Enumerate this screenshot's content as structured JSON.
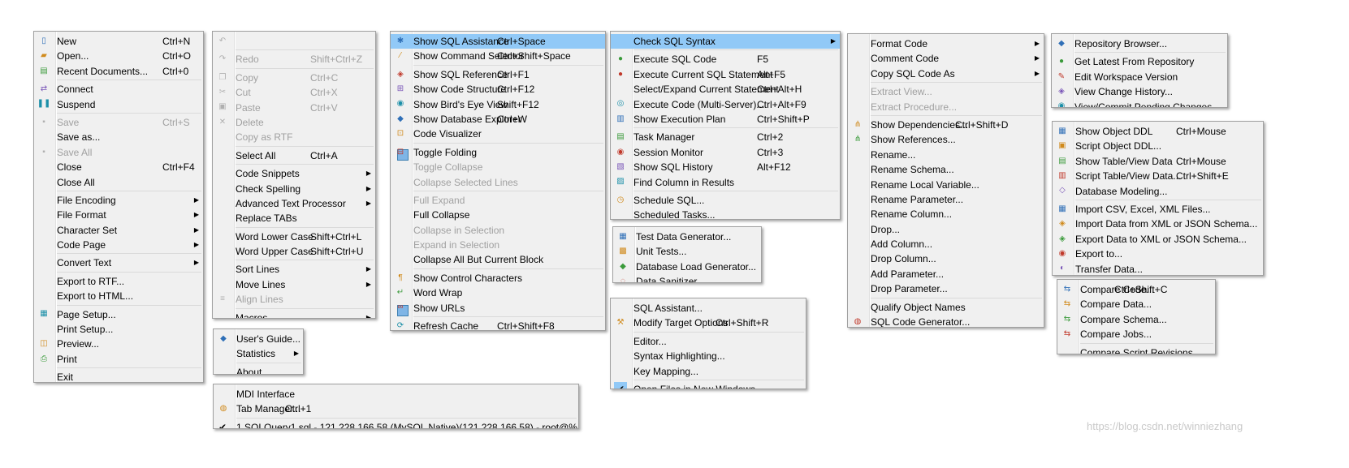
{
  "file_menu": [
    {
      "label": "New",
      "shortcut": "Ctrl+N",
      "icon": "new-file-icon"
    },
    {
      "label": "Open...",
      "shortcut": "Ctrl+O",
      "icon": "open-folder-icon"
    },
    {
      "label": "Recent Documents...",
      "shortcut": "Ctrl+0",
      "icon": "recent-docs-icon"
    },
    {
      "sep": true
    },
    {
      "label": "Connect",
      "icon": "connect-icon"
    },
    {
      "label": "Suspend",
      "icon": "pause-icon"
    },
    {
      "sep": true
    },
    {
      "label": "Save",
      "shortcut": "Ctrl+S",
      "icon": "save-icon",
      "disabled": true
    },
    {
      "label": "Save as..."
    },
    {
      "label": "Save All",
      "icon": "save-all-icon",
      "disabled": true
    },
    {
      "label": "Close",
      "shortcut": "Ctrl+F4"
    },
    {
      "label": "Close All"
    },
    {
      "sep": true
    },
    {
      "label": "File Encoding",
      "submenu": true
    },
    {
      "label": "File Format",
      "submenu": true
    },
    {
      "label": "Character Set",
      "submenu": true
    },
    {
      "label": "Code Page",
      "submenu": true
    },
    {
      "sep": true
    },
    {
      "label": "Convert Text",
      "submenu": true
    },
    {
      "sep": true
    },
    {
      "label": "Export to RTF..."
    },
    {
      "label": "Export to HTML..."
    },
    {
      "sep": true
    },
    {
      "label": "Page Setup...",
      "icon": "page-setup-icon"
    },
    {
      "label": "Print Setup..."
    },
    {
      "label": "Preview...",
      "icon": "preview-icon"
    },
    {
      "label": "Print",
      "icon": "print-icon"
    },
    {
      "sep": true
    },
    {
      "label": "Exit"
    }
  ],
  "edit_menu": [
    {
      "label": "",
      "icon": "undo-icon",
      "disabled": true
    },
    {
      "sep": true
    },
    {
      "label": "Redo",
      "shortcut": "Shift+Ctrl+Z",
      "icon": "redo-icon",
      "disabled": true
    },
    {
      "sep": true
    },
    {
      "label": "Copy",
      "shortcut": "Ctrl+C",
      "icon": "copy-icon",
      "disabled": true
    },
    {
      "label": "Cut",
      "shortcut": "Ctrl+X",
      "icon": "cut-icon",
      "disabled": true
    },
    {
      "label": "Paste",
      "shortcut": "Ctrl+V",
      "icon": "paste-icon",
      "disabled": true
    },
    {
      "label": "Delete",
      "icon": "delete-icon",
      "disabled": true
    },
    {
      "label": "Copy as RTF",
      "disabled": true
    },
    {
      "sep": true
    },
    {
      "label": "Select All",
      "shortcut": "Ctrl+A"
    },
    {
      "sep": true
    },
    {
      "label": "Code Snippets",
      "submenu": true
    },
    {
      "label": "Check Spelling",
      "submenu": true
    },
    {
      "label": "Advanced Text Processor",
      "submenu": true
    },
    {
      "label": "Replace TABs"
    },
    {
      "sep": true
    },
    {
      "label": "Word Lower Case",
      "shortcut": "Shift+Ctrl+L"
    },
    {
      "label": "Word Upper Case",
      "shortcut": "Shift+Ctrl+U"
    },
    {
      "sep": true
    },
    {
      "label": "Sort Lines",
      "submenu": true
    },
    {
      "label": "Move Lines",
      "submenu": true
    },
    {
      "label": "Align Lines",
      "icon": "align-icon",
      "disabled": true
    },
    {
      "sep": true
    },
    {
      "label": "Macros",
      "submenu": true
    }
  ],
  "help_menu": [
    {
      "label": "User's Guide...",
      "icon": "help-book-icon"
    },
    {
      "label": "Statistics",
      "submenu": true
    },
    {
      "sep": true
    },
    {
      "label": "About..."
    }
  ],
  "window_menu": [
    {
      "label": "MDI Interface"
    },
    {
      "label": "Tab Manager...",
      "shortcut": "Ctrl+1",
      "icon": "tab-manager-icon"
    },
    {
      "sep": true
    },
    {
      "label": "1 SQLQuery1.sql - 121.228.166.58 (MySQL Native)(121.228.166.58) - root@%",
      "checked": true
    }
  ],
  "view_menu": [
    {
      "label": "Show SQL Assistance",
      "shortcut": "Ctrl+Space",
      "icon": "sql-assist-icon",
      "highlight": true
    },
    {
      "label": "Show Command Selector",
      "shortcut": "Ctrl+Shift+Space",
      "icon": "command-selector-icon"
    },
    {
      "sep": true
    },
    {
      "label": "Show SQL Reference",
      "shortcut": "Ctrl+F1",
      "icon": "sql-reference-icon"
    },
    {
      "label": "Show Code Structure",
      "shortcut": "Ctrl+F12",
      "icon": "code-structure-icon"
    },
    {
      "label": "Show Bird's Eye View",
      "shortcut": "Shift+F12",
      "icon": "birds-eye-icon"
    },
    {
      "label": "Show Database Explorer",
      "shortcut": "Ctrl+W",
      "icon": "db-explorer-icon"
    },
    {
      "label": "Code Visualizer",
      "icon": "code-visualizer-icon"
    },
    {
      "sep": true
    },
    {
      "label": "Toggle Folding",
      "icon": "toggle-folding-icon",
      "boxed": true
    },
    {
      "label": "Toggle Collapse",
      "disabled": true
    },
    {
      "label": "Collapse Selected Lines",
      "disabled": true
    },
    {
      "sep": true
    },
    {
      "label": "Full Expand",
      "disabled": true
    },
    {
      "label": "Full Collapse"
    },
    {
      "label": "Collapse in Selection",
      "disabled": true
    },
    {
      "label": "Expand in Selection",
      "disabled": true
    },
    {
      "label": "Collapse All But Current Block"
    },
    {
      "sep": true
    },
    {
      "label": "Show Control Characters",
      "icon": "pilcrow-icon"
    },
    {
      "label": "Word Wrap",
      "icon": "word-wrap-icon"
    },
    {
      "label": "Show URLs",
      "icon": "link-icon",
      "boxed": true
    },
    {
      "sep": true
    },
    {
      "label": "Refresh Cache",
      "shortcut": "Ctrl+Shift+F8",
      "icon": "refresh-icon"
    }
  ],
  "sql_menu": [
    {
      "label": "Check SQL Syntax",
      "submenu": true,
      "highlight": true
    },
    {
      "sep": true
    },
    {
      "label": "Execute SQL Code",
      "shortcut": "F5",
      "icon": "execute-icon"
    },
    {
      "label": "Execute Current SQL Statement",
      "shortcut": "Alt+F5",
      "icon": "execute-current-icon"
    },
    {
      "label": "Select/Expand Current Statement",
      "shortcut": "Ctrl+Alt+H"
    },
    {
      "label": "Execute Code (Multi-Server)...",
      "shortcut": "Ctrl+Alt+F9",
      "icon": "multi-server-icon"
    },
    {
      "label": "Show Execution Plan",
      "shortcut": "Ctrl+Shift+P",
      "icon": "execution-plan-icon"
    },
    {
      "sep": true
    },
    {
      "label": "Task Manager",
      "shortcut": "Ctrl+2",
      "icon": "task-manager-icon"
    },
    {
      "label": "Session Monitor",
      "shortcut": "Ctrl+3",
      "icon": "session-monitor-icon"
    },
    {
      "label": "Show SQL History",
      "shortcut": "Alt+F12",
      "icon": "sql-history-icon"
    },
    {
      "label": "Find Column in Results",
      "icon": "find-column-icon"
    },
    {
      "sep": true
    },
    {
      "label": "Schedule SQL...",
      "icon": "schedule-icon"
    },
    {
      "label": "Scheduled Tasks..."
    }
  ],
  "data_menu": [
    {
      "label": "Test Data Generator...",
      "icon": "test-data-icon"
    },
    {
      "label": "Unit Tests...",
      "icon": "unit-tests-icon"
    },
    {
      "label": "Database Load Generator...",
      "icon": "load-generator-icon"
    },
    {
      "label": "Data Sanitizer...",
      "icon": "sanitizer-icon"
    }
  ],
  "options_menu": [
    {
      "label": "SQL Assistant..."
    },
    {
      "label": "Modify Target Options",
      "shortcut": "Ctrl+Shift+R",
      "icon": "target-options-icon"
    },
    {
      "sep": true
    },
    {
      "label": "Editor..."
    },
    {
      "label": "Syntax Highlighting..."
    },
    {
      "label": "Key Mapping..."
    },
    {
      "sep": true
    },
    {
      "label": "Open Files in New Windows",
      "checked": true,
      "boxedcheck": true
    }
  ],
  "refactor_menu": [
    {
      "label": "Format Code",
      "submenu": true
    },
    {
      "label": "Comment Code",
      "submenu": true
    },
    {
      "label": "Copy SQL Code As",
      "submenu": true
    },
    {
      "sep": true
    },
    {
      "label": "Extract View...",
      "disabled": true
    },
    {
      "label": "Extract Procedure...",
      "disabled": true
    },
    {
      "sep": true
    },
    {
      "label": "Show Dependencies...",
      "shortcut": "Ctrl+Shift+D",
      "icon": "dependencies-icon"
    },
    {
      "label": "Show References...",
      "icon": "references-icon"
    },
    {
      "label": "Rename..."
    },
    {
      "label": "Rename Schema..."
    },
    {
      "label": "Rename Local Variable..."
    },
    {
      "label": "Rename Parameter..."
    },
    {
      "label": "Rename Column..."
    },
    {
      "label": "Drop..."
    },
    {
      "label": "Add Column..."
    },
    {
      "label": "Drop Column..."
    },
    {
      "label": "Add Parameter..."
    },
    {
      "label": "Drop Parameter..."
    },
    {
      "sep": true
    },
    {
      "label": "Qualify Object Names"
    },
    {
      "label": "SQL Code Generator...",
      "icon": "code-generator-icon"
    }
  ],
  "repo_menu": [
    {
      "label": "Repository Browser...",
      "icon": "repository-icon"
    },
    {
      "sep": true
    },
    {
      "label": "Get Latest From Repository",
      "icon": "get-latest-icon"
    },
    {
      "label": "Edit Workspace Version",
      "icon": "edit-workspace-icon"
    },
    {
      "label": "View Change History...",
      "icon": "change-history-icon"
    },
    {
      "label": "View/Commit Pending Changes...",
      "icon": "commit-icon"
    }
  ],
  "ddl_menu": [
    {
      "label": "Show Object DDL",
      "shortcut": "Ctrl+Mouse",
      "icon": "object-ddl-icon"
    },
    {
      "label": "Script Object DDL...",
      "icon": "script-ddl-icon"
    },
    {
      "label": "Show Table/View Data",
      "shortcut": "Ctrl+Mouse",
      "icon": "table-data-icon"
    },
    {
      "label": "Script Table/View Data...",
      "shortcut": "Ctrl+Shift+E",
      "icon": "script-table-icon"
    },
    {
      "label": "Database Modeling...",
      "icon": "db-modeling-icon"
    },
    {
      "sep": true
    },
    {
      "label": "Import CSV, Excel, XML Files...",
      "icon": "import-csv-icon"
    },
    {
      "label": "Import Data from XML or JSON Schema...",
      "icon": "import-xml-icon"
    },
    {
      "label": "Export Data to XML or JSON Schema...",
      "icon": "export-xml-icon"
    },
    {
      "label": "Export to...",
      "icon": "export-icon"
    },
    {
      "label": "Transfer Data...",
      "icon": "transfer-icon"
    }
  ],
  "compare_menu": [
    {
      "label": "Compare Code...",
      "shortcut": "Ctrl+Shift+C",
      "icon": "compare-code-icon"
    },
    {
      "label": "Compare Data...",
      "icon": "compare-data-icon"
    },
    {
      "label": "Compare Schema...",
      "icon": "compare-schema-icon"
    },
    {
      "label": "Compare Jobs...",
      "icon": "compare-jobs-icon"
    },
    {
      "sep": true
    },
    {
      "label": "Compare Script Revisions..."
    }
  ],
  "watermark": "https://blog.csdn.net/winniezhang",
  "colors": {
    "highlight": "#91c9f7",
    "disabled": "#a0a0a0",
    "menu_bg": "#f0f0f0"
  }
}
